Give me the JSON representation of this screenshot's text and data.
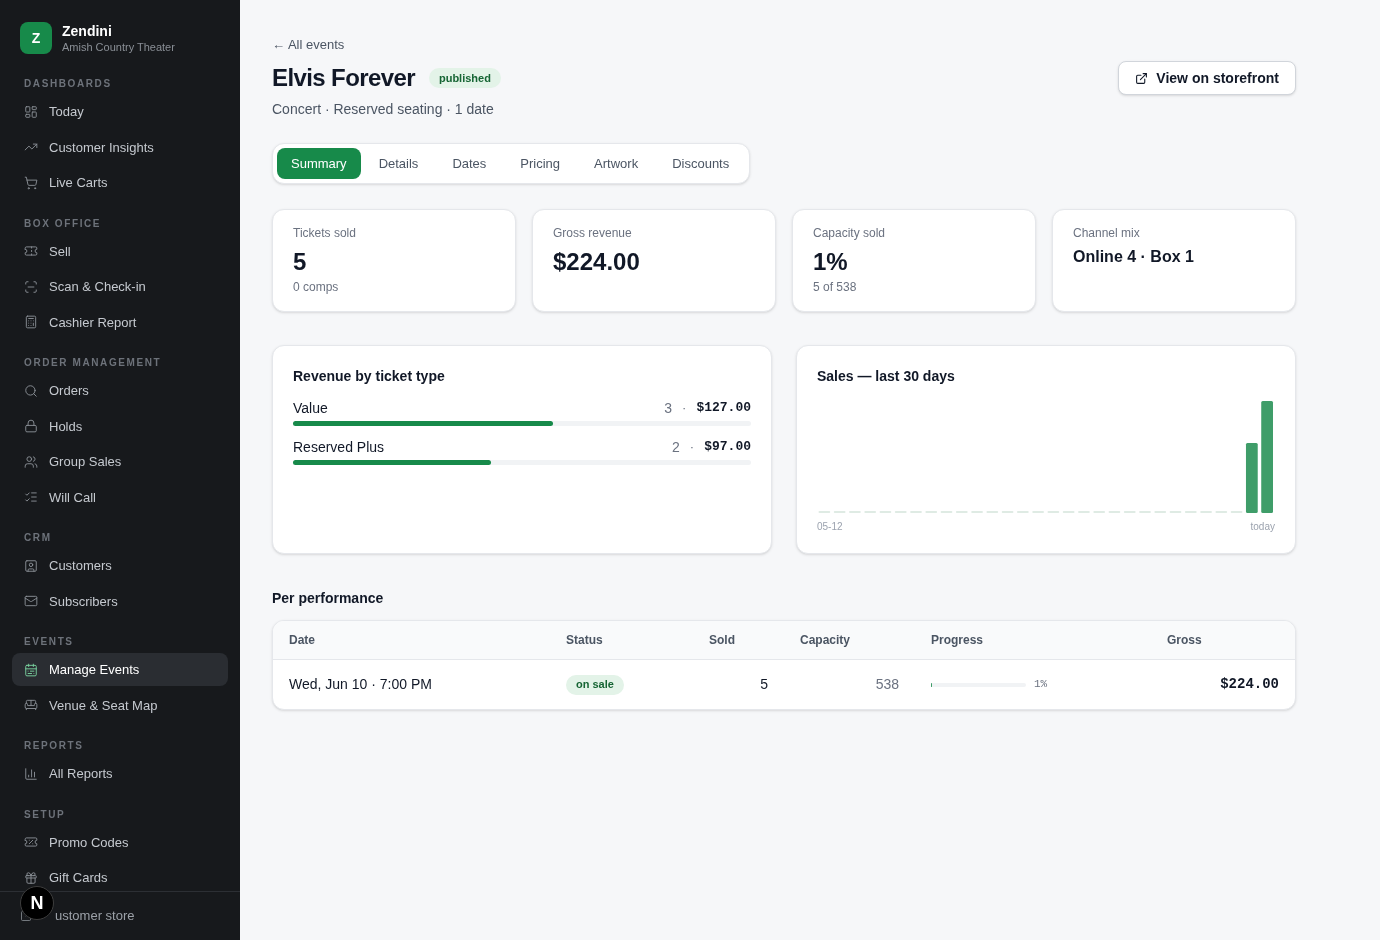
{
  "sidebar": {
    "brand": {
      "logo": "Z",
      "name": "Zendini",
      "subtitle": "Amish Country Theater"
    },
    "sections": [
      {
        "title": "DASHBOARDS",
        "items": [
          {
            "label": "Today",
            "selected": false
          },
          {
            "label": "Customer Insights",
            "selected": false
          },
          {
            "label": "Live Carts",
            "selected": false
          }
        ]
      },
      {
        "title": "BOX OFFICE",
        "items": [
          {
            "label": "Sell",
            "selected": false
          },
          {
            "label": "Scan & Check-in",
            "selected": false
          },
          {
            "label": "Cashier Report",
            "selected": false
          }
        ]
      },
      {
        "title": "ORDER MANAGEMENT",
        "items": [
          {
            "label": "Orders",
            "selected": false
          },
          {
            "label": "Holds",
            "selected": false
          },
          {
            "label": "Group Sales",
            "selected": false
          },
          {
            "label": "Will Call",
            "selected": false
          }
        ]
      },
      {
        "title": "CRM",
        "items": [
          {
            "label": "Customers",
            "selected": false
          },
          {
            "label": "Subscribers",
            "selected": false
          }
        ]
      },
      {
        "title": "EVENTS",
        "items": [
          {
            "label": "Manage Events",
            "selected": true
          },
          {
            "label": "Venue & Seat Map",
            "selected": false
          }
        ]
      },
      {
        "title": "REPORTS",
        "items": [
          {
            "label": "All Reports",
            "selected": false
          }
        ]
      },
      {
        "title": "SETUP",
        "items": [
          {
            "label": "Promo Codes",
            "selected": false
          },
          {
            "label": "Gift Cards",
            "selected": false
          }
        ]
      }
    ],
    "footer_link": {
      "label": "ustomer store"
    }
  },
  "dev_badge": {
    "label": "N"
  },
  "header": {
    "back_link": "← All events",
    "title": "Elvis Forever",
    "status": "published",
    "subtitle": "Concert · Reserved seating · 1 date",
    "action_button": "View on storefront"
  },
  "tabs": [
    {
      "label": "Summary",
      "selected": true
    },
    {
      "label": "Details",
      "selected": false
    },
    {
      "label": "Dates",
      "selected": false
    },
    {
      "label": "Pricing",
      "selected": false
    },
    {
      "label": "Artwork",
      "selected": false
    },
    {
      "label": "Discounts",
      "selected": false
    }
  ],
  "stats": [
    {
      "kind": "metric",
      "label": "Tickets sold",
      "value": "5",
      "note": "0 comps"
    },
    {
      "kind": "metric",
      "label": "Gross revenue",
      "value": "$224.00"
    },
    {
      "kind": "metric",
      "label": "Capacity sold",
      "value": "1%",
      "note": "5 of 538"
    },
    {
      "kind": "text",
      "label": "Channel mix",
      "value": "Online 4 · Box 1"
    }
  ],
  "revenue_by_ticket_type": {
    "title": "Revenue by ticket type",
    "rows": [
      {
        "name": "Value",
        "count": "3",
        "separator": "·",
        "amount": "$127.00",
        "level": 0.567
      },
      {
        "name": "Reserved Plus",
        "count": "2",
        "separator": "·",
        "amount": "$97.00",
        "level": 0.433
      }
    ]
  },
  "sales_chart": {
    "title": "Sales — last 30 days",
    "x_start_label": "05-12",
    "x_end_label": "today"
  },
  "per_performance": {
    "title": "Per performance",
    "columns": [
      "Date",
      "Status",
      "Sold",
      "Capacity",
      "Progress",
      "Gross"
    ],
    "rows": [
      {
        "date": "Wed, Jun 10 · 7:00 PM",
        "status": "on sale",
        "sold": "5",
        "capacity": "538",
        "progress": {
          "level": 0.01,
          "label": "1%"
        },
        "gross": "$224.00"
      }
    ]
  }
}
